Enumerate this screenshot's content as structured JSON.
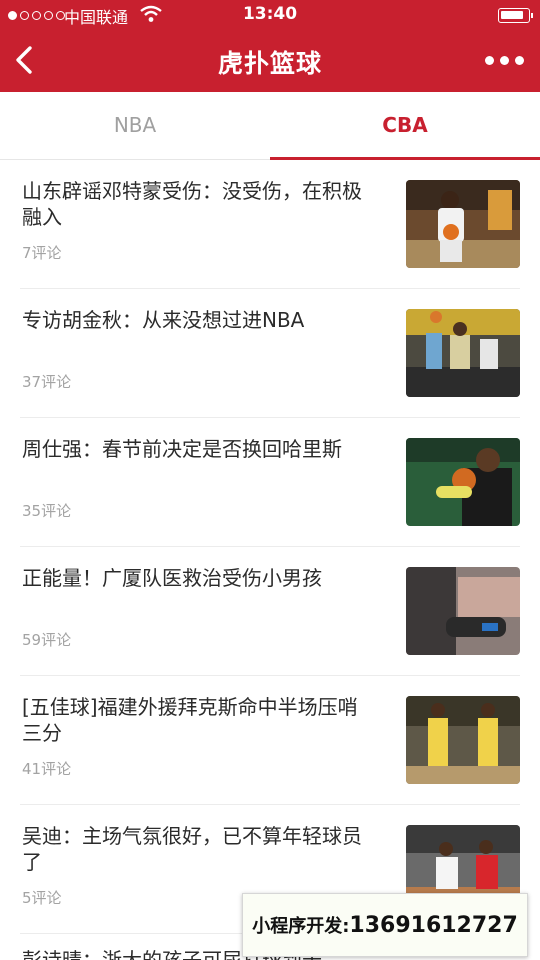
{
  "status_bar": {
    "carrier": "中国联通",
    "time": "13:40"
  },
  "nav": {
    "title": "虎扑篮球"
  },
  "tabs": [
    {
      "label": "NBA",
      "active": false
    },
    {
      "label": "CBA",
      "active": true
    }
  ],
  "news": [
    {
      "title": "山东辟谣邓特蒙受伤：没受伤，在积极融入",
      "comments": "7评论",
      "image": "player-dribbling-photo"
    },
    {
      "title": "专访胡金秋：从来没想过进NBA",
      "comments": "37评论",
      "image": "player-shooting-photo"
    },
    {
      "title": "周仕强：春节前决定是否换回哈里斯",
      "comments": "35评论",
      "image": "player-holding-ball-photo"
    },
    {
      "title": "正能量！广厦队医救治受伤小男孩",
      "comments": "59评论",
      "image": "medic-treatment-photo"
    },
    {
      "title": "[五佳球]福建外援拜克斯命中半场压哨三分",
      "comments": "41评论",
      "image": "two-players-standing-photo"
    },
    {
      "title": "吴迪：主场气氛很好，已不算年轻球员了",
      "comments": "5评论",
      "image": "game-action-photo"
    }
  ],
  "partial_item_title": "彭诗晴：浙大的孩子可尿打球到十",
  "promo": {
    "label": "小程序开发:",
    "phone": "13691612727"
  },
  "colors": {
    "brand_red": "#c8202f",
    "tab_inactive": "#a0a0a0",
    "meta_gray": "#a3a3a3"
  }
}
